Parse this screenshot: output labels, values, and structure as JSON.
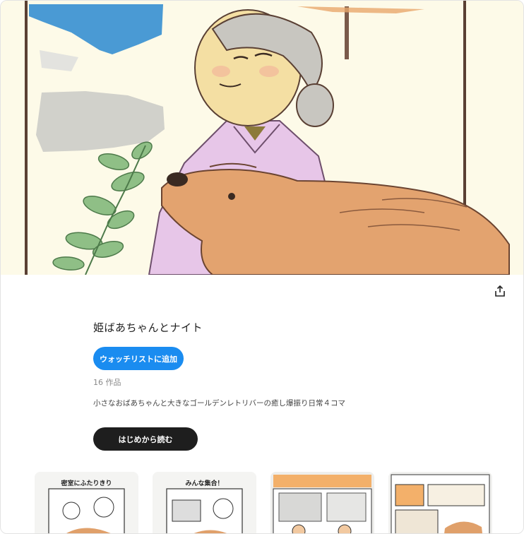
{
  "series": {
    "title": "姫ばあちゃんとナイト",
    "watchlist_label": "ウォッチリストに追加",
    "count_label": "16 作品",
    "description": "小さなおばあちゃんと大きなゴールデンレトリバーの癒し爆振り日常４コマ",
    "read_label": "はじめから読む"
  },
  "episodes": [
    {
      "caption": "密室にふたりきり"
    },
    {
      "caption": "みんな集合！"
    },
    {
      "caption": ""
    },
    {
      "caption": ""
    }
  ],
  "colors": {
    "accent": "#1a8cf0",
    "dark_button": "#1e1e1e",
    "hero_background": "#fdfae8"
  },
  "icons": {
    "share": "share-icon"
  }
}
